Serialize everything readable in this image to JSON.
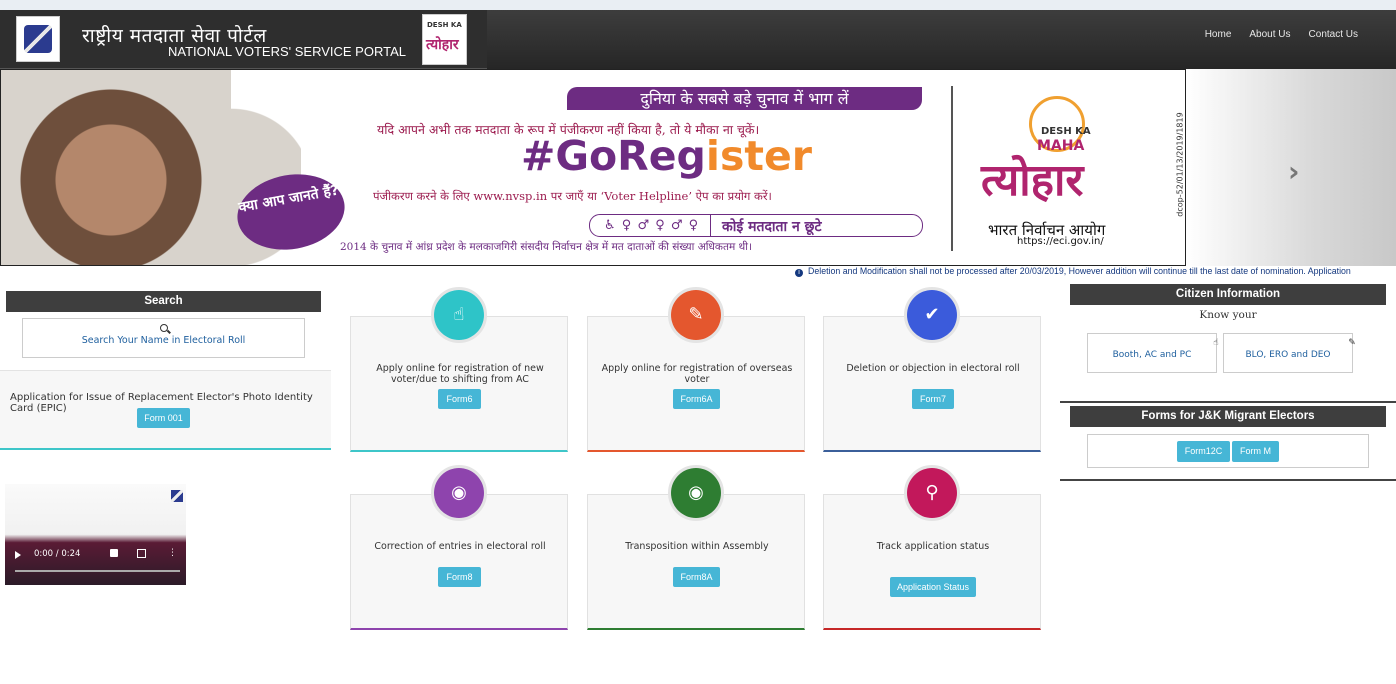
{
  "header": {
    "title_hindi": "राष्ट्रीय मतदाता सेवा पोर्टल",
    "title_english": "NATIONAL VOTERS' SERVICE PORTAL",
    "nav": [
      "Home",
      "About Us",
      "Contact Us"
    ]
  },
  "banner": {
    "headline": "दुनिया के सबसे बड़े चुनाव में भाग लें",
    "line2": "यदि आपने अभी तक मतदाता के रूप में पंजीकरण नहीं किया है, तो ये मौका ना चूकें।",
    "hashtag_a": "#GoReg",
    "hashtag_b": "ister",
    "line3": "पंजीकरण करने के लिए www.nvsp.in पर जाएँ या ‘Voter Helpline’ ऐप का प्रयोग करें।",
    "pill_text": "कोई मतदाता न छूटे",
    "line4": "2014 के चुनाव में आंध्र प्रदेश के मलकाजगिरी संसदीय निर्वाचन क्षेत्र में मत दाताओं की संख्या अधिकतम थी।",
    "bubble": "क्या आप जानते हैं?",
    "logo_desh": "DESH KA",
    "logo_maha": "MAHA",
    "logo_tyohar": "त्योहार",
    "eci_hindi": "भारत निर्वाचन आयोग",
    "eci_url": "https://eci.gov.in/",
    "code": "dcop-52/01/13/2019/1819"
  },
  "notice": "Deletion and Modification shall not be processed after 20/03/2019, However addition will continue till the last date of nomination. Application",
  "search": {
    "heading": "Search",
    "link": "Search Your Name in Electoral Roll"
  },
  "epic": {
    "title": "Application for Issue of Replacement Elector's Photo Identity Card (EPIC)",
    "button": "Form 001"
  },
  "video": {
    "time": "0:00 / 0:24"
  },
  "cards": [
    {
      "title": "Apply online for registration of new voter/due to shifting from AC",
      "button": "Form6",
      "color": "#2ec4c8",
      "accent": "#3ec6c9"
    },
    {
      "title": "Apply online for registration of overseas voter",
      "button": "Form6A",
      "color": "#e4572e",
      "accent": "#e4572e"
    },
    {
      "title": "Deletion or objection in electoral roll",
      "button": "Form7",
      "color": "#3b5bdb",
      "accent": "#3b5f9a"
    },
    {
      "title": "Correction of entries in electoral roll",
      "button": "Form8",
      "color": "#8e44ad",
      "accent": "#8e44ad"
    },
    {
      "title": "Transposition within Assembly",
      "button": "Form8A",
      "color": "#2e7d32",
      "accent": "#2e7d32"
    },
    {
      "title": "Track application status",
      "button": "Application Status",
      "color": "#c2185b",
      "accent": "#c62828"
    }
  ],
  "citizen": {
    "heading": "Citizen Information",
    "know": "Know your",
    "booth": "Booth, AC and PC",
    "blo": "BLO, ERO and DEO"
  },
  "jk": {
    "heading": "Forms for J&K Migrant Electors",
    "btn1": "Form12C",
    "btn2": "Form M"
  }
}
